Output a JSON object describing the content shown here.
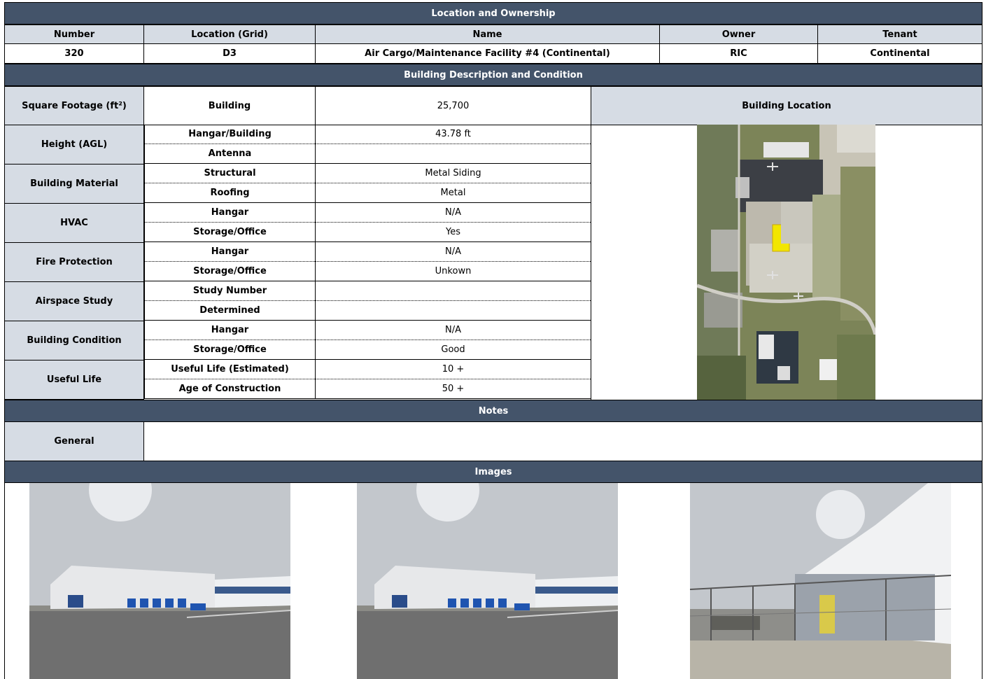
{
  "sections": {
    "location": "Location and Ownership",
    "description": "Building Description and Condition",
    "notes": "Notes",
    "images": "Images"
  },
  "ownership": {
    "headers": [
      "Number",
      "Location (Grid)",
      "Name",
      "Owner",
      "Tenant"
    ],
    "values": [
      "320",
      "D3",
      "Air Cargo/Maintenance Facility #4 (Continental)",
      "RIC",
      "Continental"
    ]
  },
  "square_footage": {
    "label": "Square Footage (ft²)",
    "sub": "Building",
    "value": "25,700"
  },
  "building_location_label": "Building Location",
  "rows": [
    {
      "label": "Height (AGL)",
      "items": [
        {
          "sub": "Hangar/Building",
          "value": "43.78 ft"
        },
        {
          "sub": "Antenna",
          "value": ""
        }
      ]
    },
    {
      "label": "Building Material",
      "items": [
        {
          "sub": "Structural",
          "value": "Metal Siding"
        },
        {
          "sub": "Roofing",
          "value": "Metal"
        }
      ]
    },
    {
      "label": "HVAC",
      "items": [
        {
          "sub": "Hangar",
          "value": "N/A"
        },
        {
          "sub": "Storage/Office",
          "value": "Yes"
        }
      ]
    },
    {
      "label": "Fire Protection",
      "items": [
        {
          "sub": "Hangar",
          "value": "N/A"
        },
        {
          "sub": "Storage/Office",
          "value": "Unkown"
        }
      ]
    },
    {
      "label": "Airspace Study",
      "items": [
        {
          "sub": "Study Number",
          "value": ""
        },
        {
          "sub": "Determined",
          "value": ""
        }
      ]
    },
    {
      "label": "Building Condition",
      "items": [
        {
          "sub": "Hangar",
          "value": "N/A"
        },
        {
          "sub": "Storage/Office",
          "value": "Good"
        }
      ]
    },
    {
      "label": "Useful Life",
      "items": [
        {
          "sub": "Useful Life (Estimated)",
          "value": "10 +"
        },
        {
          "sub": "Age of Construction",
          "value": "50 +"
        }
      ]
    }
  ],
  "notes": {
    "label": "General",
    "value": ""
  },
  "colors": {
    "band": "#44546a",
    "label_bg": "#d6dce4",
    "highlight": "#f2e600"
  }
}
